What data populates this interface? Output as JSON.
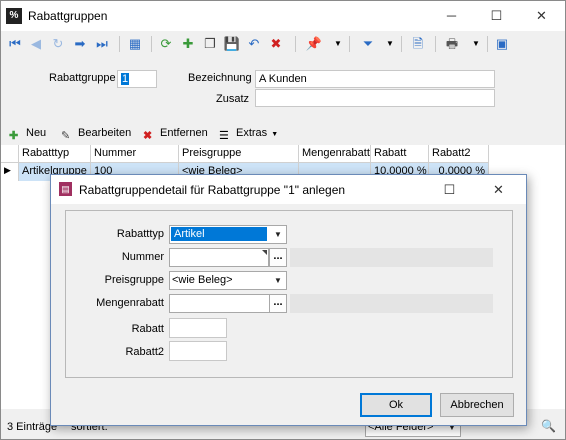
{
  "app": {
    "icon_text": "%",
    "title": "Rabattgruppen"
  },
  "window_controls": {
    "minimize": "─",
    "maximize": "☐",
    "close": "✕"
  },
  "header_form": {
    "rabattgruppe_label": "Rabattgruppe",
    "rabattgruppe_value": "1",
    "bezeichnung_label": "Bezeichnung",
    "bezeichnung_value": "A Kunden",
    "zusatz_label": "Zusatz",
    "zusatz_value": ""
  },
  "grid_toolbar": {
    "neu": "Neu",
    "bearbeiten": "Bearbeiten",
    "entfernen": "Entfernen",
    "extras": "Extras"
  },
  "grid": {
    "columns": [
      "Rabatttyp",
      "Nummer",
      "Preisgruppe",
      "Mengenrabatt",
      "Rabatt",
      "Rabatt2"
    ],
    "row": [
      "Artikelgruppe",
      "100",
      "<wie Beleg>",
      "",
      "10,0000 %",
      "0,0000 %"
    ]
  },
  "status": {
    "count": "3 Einträge",
    "sort": "sortiert:",
    "filter_select": "<Alle Felder>"
  },
  "dialog": {
    "title": "Rabattgruppendetail für Rabattgruppe \"1\" anlegen",
    "fields": {
      "rabatttyp_label": "Rabatttyp",
      "rabatttyp_value": "Artikel",
      "nummer_label": "Nummer",
      "nummer_value": "",
      "preisgruppe_label": "Preisgruppe",
      "preisgruppe_value": "<wie Beleg>",
      "mengenrabatt_label": "Mengenrabatt",
      "mengenrabatt_value": "",
      "rabatt_label": "Rabatt",
      "rabatt_value": "",
      "rabatt2_label": "Rabatt2",
      "rabatt2_value": ""
    },
    "ellipsis": "...",
    "ok": "Ok",
    "cancel": "Abbrechen"
  },
  "colors": {
    "selection": "#0078d7",
    "row_highlight": "#cde3f7",
    "nav_blue": "#2a6bc4"
  }
}
